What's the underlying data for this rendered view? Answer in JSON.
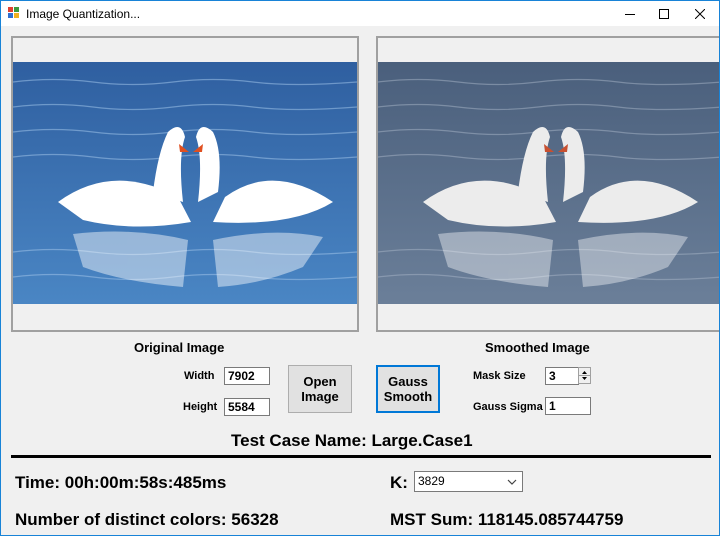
{
  "window": {
    "title": "Image Quantization...",
    "controls": {
      "minimize": "minimize-icon",
      "maximize": "maximize-icon",
      "close": "close-icon"
    }
  },
  "original": {
    "label": "Original Image",
    "width_label": "Width",
    "width_value": "7902",
    "height_label": "Height",
    "height_value": "5584"
  },
  "buttons": {
    "open": "Open Image",
    "gauss": "Gauss Smooth"
  },
  "smoothed": {
    "label": "Smoothed Image",
    "mask_label": "Mask Size",
    "mask_value": "3",
    "sigma_label": "Gauss Sigma",
    "sigma_value": "1"
  },
  "test_case": "Test Case Name: Large.Case1",
  "stats": {
    "time": "Time: 00h:00m:58s:485ms",
    "distinct": "Number of distinct colors: 56328",
    "k_label": "K:",
    "k_value": "3829",
    "mst": "MST Sum: 118145.085744759"
  },
  "colors": {
    "accent": "#0078d7",
    "water_orig": "#3a6fb0",
    "water_smooth": "#5a6f8c"
  }
}
